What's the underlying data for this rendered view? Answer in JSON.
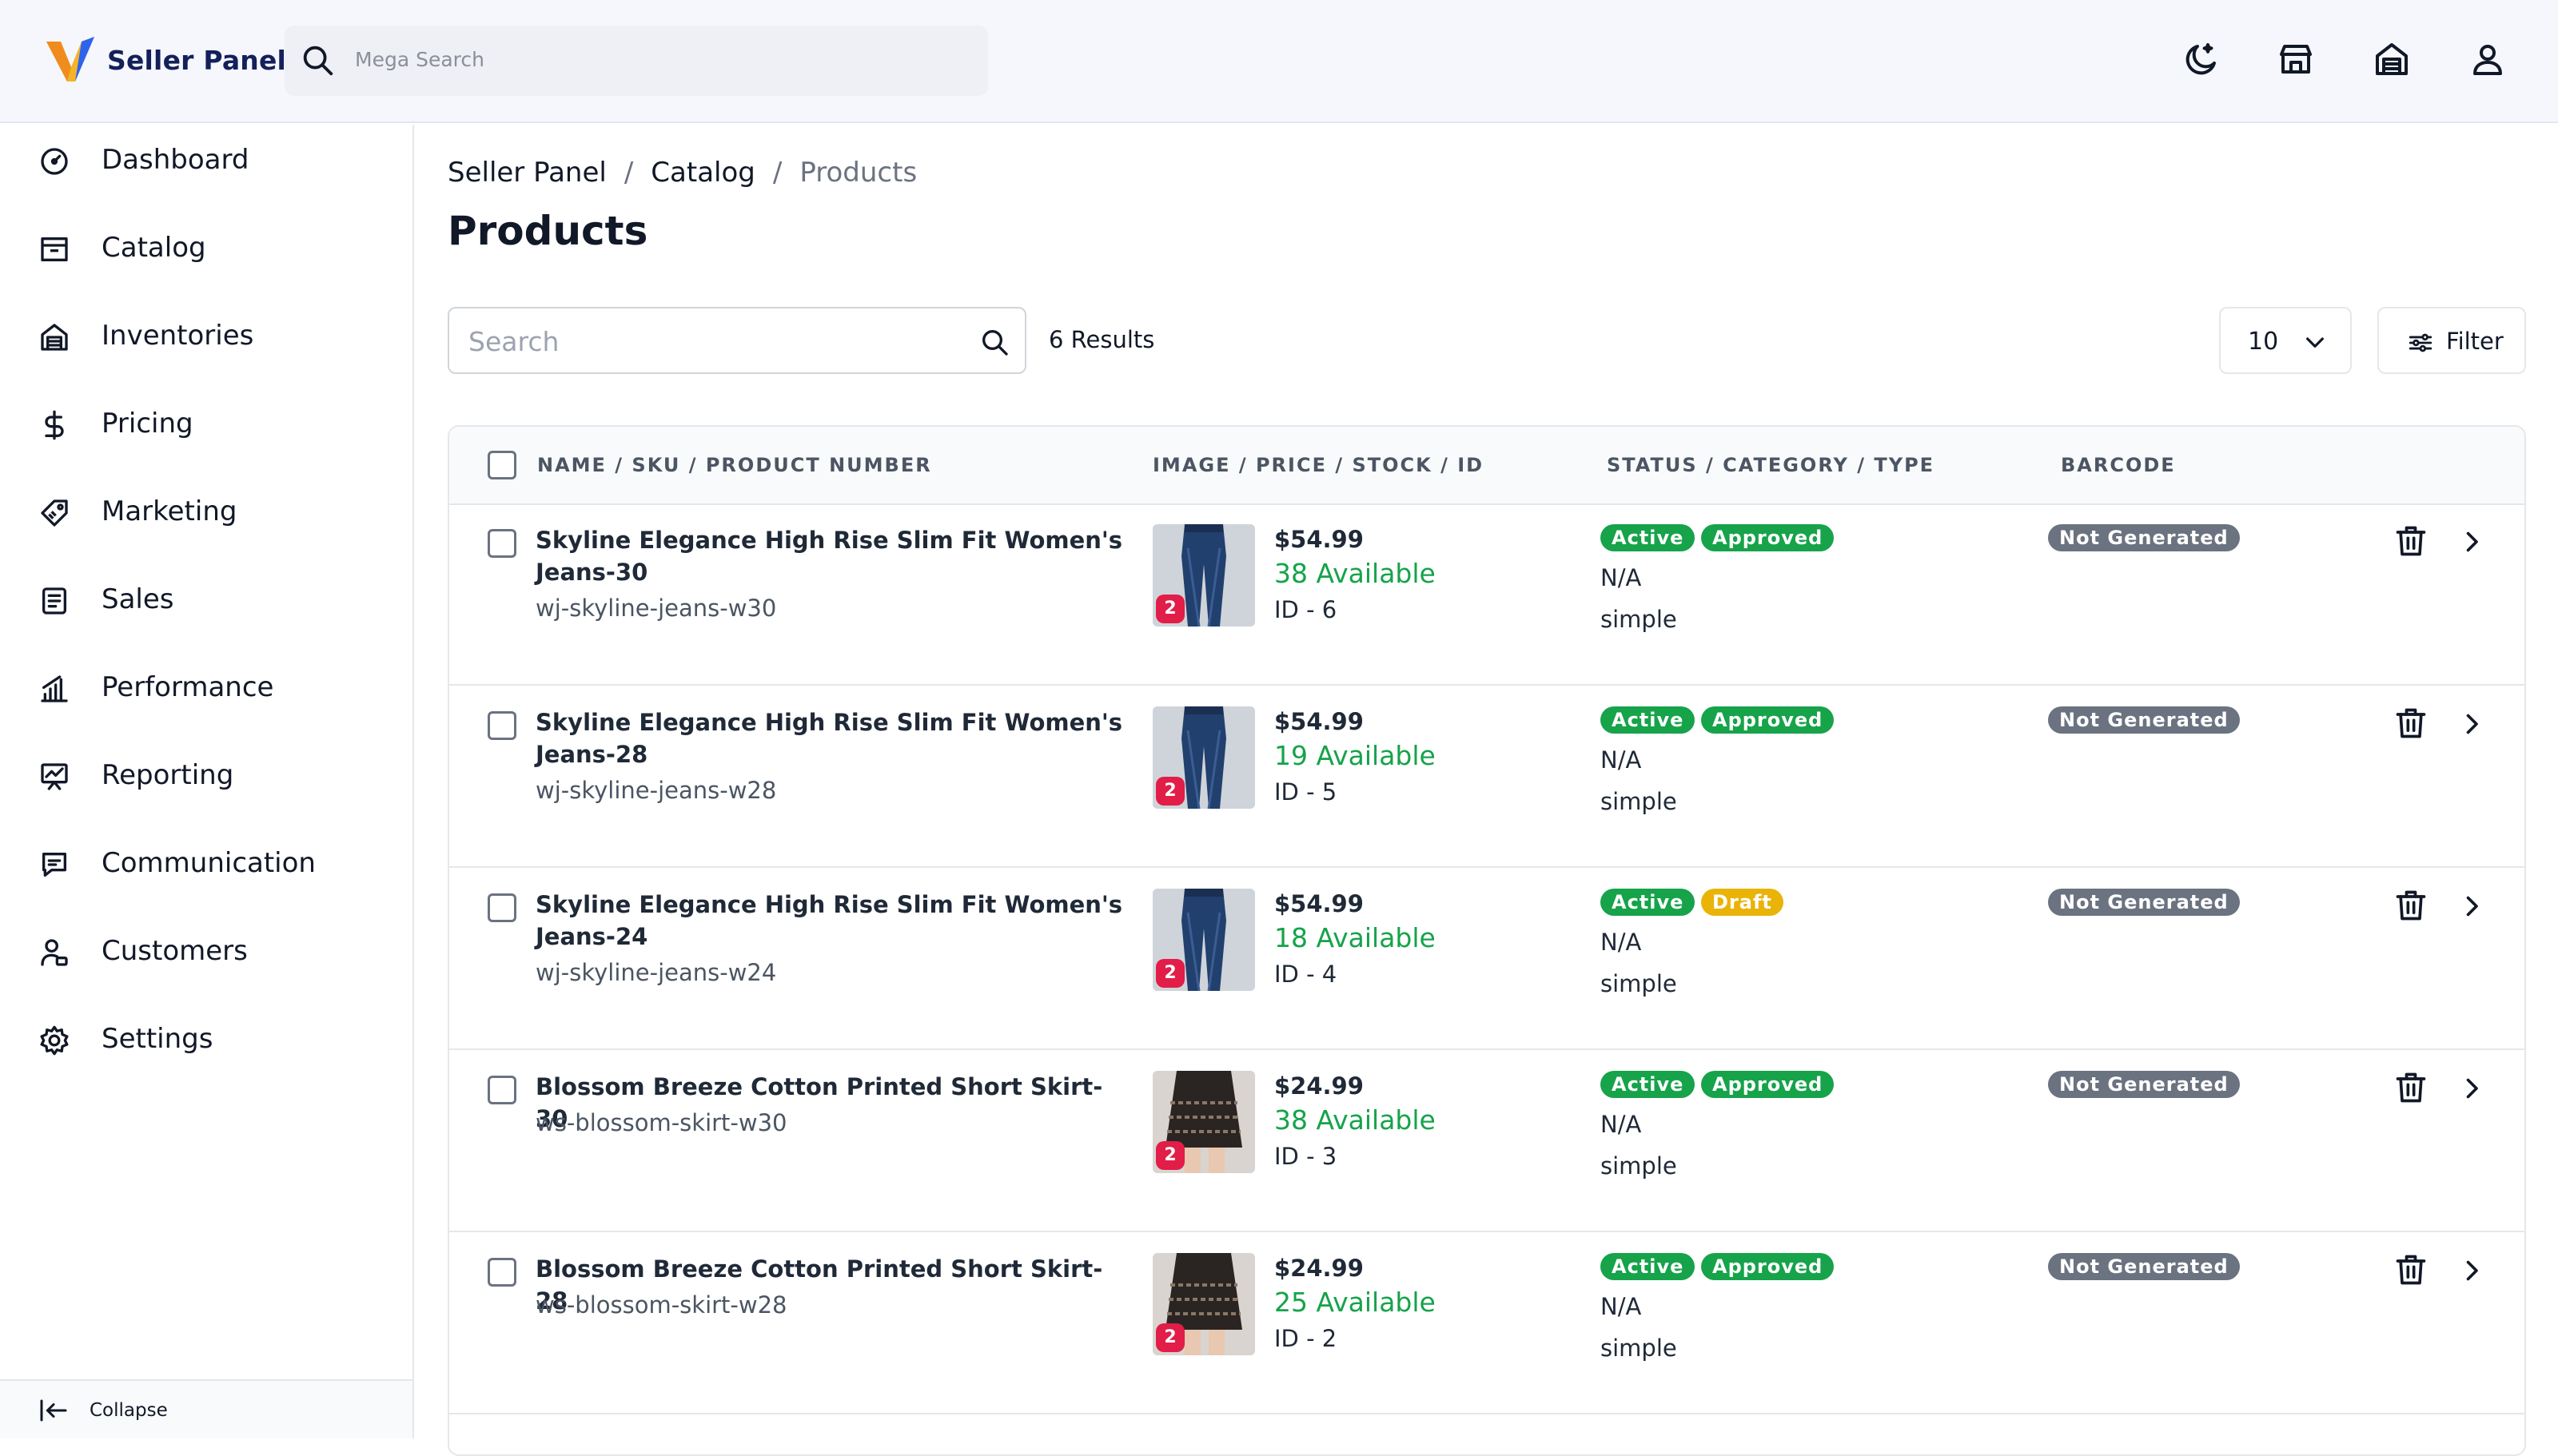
{
  "app": {
    "name": "Seller Panel"
  },
  "search": {
    "placeholder": "Mega Search"
  },
  "sidebar": {
    "items": [
      {
        "label": "Dashboard",
        "icon": "dashboard-icon"
      },
      {
        "label": "Catalog",
        "icon": "catalog-icon"
      },
      {
        "label": "Inventories",
        "icon": "inventories-icon"
      },
      {
        "label": "Pricing",
        "icon": "dollar-icon"
      },
      {
        "label": "Marketing",
        "icon": "tag-icon"
      },
      {
        "label": "Sales",
        "icon": "sales-icon"
      },
      {
        "label": "Performance",
        "icon": "performance-icon"
      },
      {
        "label": "Reporting",
        "icon": "reporting-icon"
      },
      {
        "label": "Communication",
        "icon": "message-icon"
      },
      {
        "label": "Customers",
        "icon": "customers-icon"
      },
      {
        "label": "Settings",
        "icon": "gear-icon"
      }
    ],
    "collapse": "Collapse"
  },
  "breadcrumb": {
    "items": [
      "Seller Panel",
      "Catalog",
      "Products"
    ],
    "separator": "/"
  },
  "page": {
    "title": "Products",
    "search_placeholder": "Search",
    "results": "6 Results",
    "page_size": "10",
    "filter": "Filter"
  },
  "table": {
    "headers": [
      "NAME / SKU / PRODUCT NUMBER",
      "IMAGE / PRICE / STOCK / ID",
      "STATUS / CATEGORY / TYPE",
      "BARCODE"
    ],
    "rows": [
      {
        "name": "Skyline Elegance High Rise Slim Fit Women's Jeans-30",
        "sku": "wj-skyline-jeans-w30",
        "image_count": "2",
        "image": "jeans",
        "price": "$54.99",
        "stock": "38 Available",
        "id": "ID - 6",
        "status": "Active",
        "approval": "Approved",
        "approval_color": "#16a34a",
        "category": "N/A",
        "type": "simple",
        "barcode": "Not Generated"
      },
      {
        "name": "Skyline Elegance High Rise Slim Fit Women's Jeans-28",
        "sku": "wj-skyline-jeans-w28",
        "image_count": "2",
        "image": "jeans",
        "price": "$54.99",
        "stock": "19 Available",
        "id": "ID - 5",
        "status": "Active",
        "approval": "Approved",
        "approval_color": "#16a34a",
        "category": "N/A",
        "type": "simple",
        "barcode": "Not Generated"
      },
      {
        "name": "Skyline Elegance High Rise Slim Fit Women's Jeans-24",
        "sku": "wj-skyline-jeans-w24",
        "image_count": "2",
        "image": "jeans",
        "price": "$54.99",
        "stock": "18 Available",
        "id": "ID - 4",
        "status": "Active",
        "approval": "Draft",
        "approval_color": "#eab308",
        "category": "N/A",
        "type": "simple",
        "barcode": "Not Generated"
      },
      {
        "name": "Blossom Breeze Cotton Printed Short Skirt-30",
        "sku": "ws-blossom-skirt-w30",
        "image_count": "2",
        "image": "skirt",
        "price": "$24.99",
        "stock": "38 Available",
        "id": "ID - 3",
        "status": "Active",
        "approval": "Approved",
        "approval_color": "#16a34a",
        "category": "N/A",
        "type": "simple",
        "barcode": "Not Generated"
      },
      {
        "name": "Blossom Breeze Cotton Printed Short Skirt- 28",
        "sku": "ws-blossom-skirt-w28",
        "image_count": "2",
        "image": "skirt",
        "price": "$24.99",
        "stock": "25 Available",
        "id": "ID - 2",
        "status": "Active",
        "approval": "Approved",
        "approval_color": "#16a34a",
        "category": "N/A",
        "type": "simple",
        "barcode": "Not Generated"
      }
    ]
  },
  "colors": {
    "brand": "#13205a",
    "success": "#16a34a",
    "warning": "#eab308",
    "danger": "#e11d48",
    "muted": "#6b7280"
  }
}
